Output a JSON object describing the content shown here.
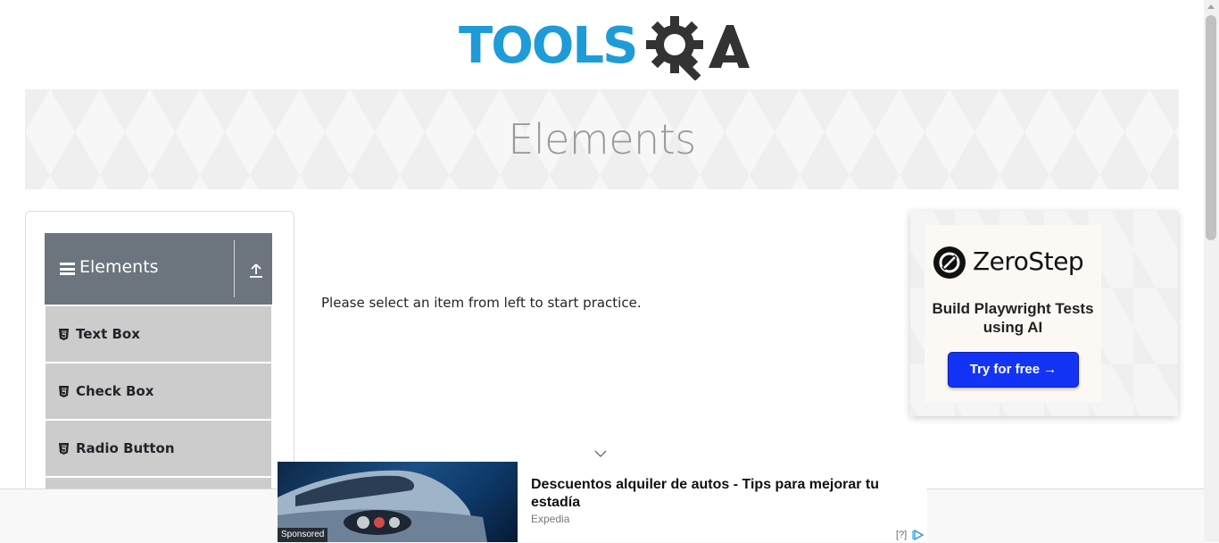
{
  "header": {
    "logo_text": "TOOLS",
    "logo_text_2": "QA",
    "brand_color": "#1f9bd7",
    "dark_color": "#333333"
  },
  "banner": {
    "title": "Elements"
  },
  "sidebar": {
    "group_title": "Elements",
    "items": [
      {
        "label": "Text Box",
        "icon": "html5-icon"
      },
      {
        "label": "Check Box",
        "icon": "html5-icon"
      },
      {
        "label": "Radio Button",
        "icon": "html5-icon"
      }
    ]
  },
  "main": {
    "message": "Please select an item from left to start practice."
  },
  "side_ad": {
    "brand": "ZeroStep",
    "tagline": "Build Playwright Tests using AI",
    "cta": "Try for free →",
    "cta_color": "#1434f5"
  },
  "bottom_ad": {
    "sponsored": "Sponsored",
    "title": "Descuentos alquiler de autos - Tips para mejorar tu estadía",
    "source": "Expedia",
    "help": "[?]"
  }
}
